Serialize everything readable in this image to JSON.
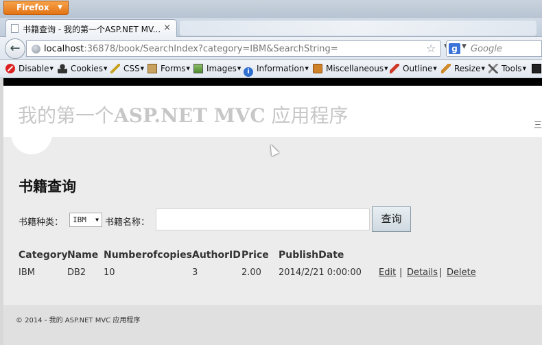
{
  "browser": {
    "app_button": "Firefox",
    "tab_title": "书籍查询 - 我的第一个ASP.NET MV...",
    "tab_close": "×",
    "url_host": "localhost",
    "url_rest": ":36878/book/SearchIndex?category=IBM&SearchString=",
    "search_placeholder": "Google",
    "search_engine_letter": "g"
  },
  "devtoolbar": {
    "items": [
      {
        "label": "Disable",
        "icon": "disable-icon"
      },
      {
        "label": "Cookies",
        "icon": "cookies-icon"
      },
      {
        "label": "CSS",
        "icon": "css-icon"
      },
      {
        "label": "Forms",
        "icon": "forms-icon"
      },
      {
        "label": "Images",
        "icon": "images-icon"
      },
      {
        "label": "Information",
        "icon": "information-icon"
      },
      {
        "label": "Miscellaneous",
        "icon": "miscellaneous-icon"
      },
      {
        "label": "Outline",
        "icon": "outline-icon"
      },
      {
        "label": "Resize",
        "icon": "resize-icon"
      },
      {
        "label": "Tools",
        "icon": "tools-icon"
      }
    ]
  },
  "page": {
    "site_title_pre": "我的第一个",
    "site_title_bold": "ASP.NET MVC",
    "site_title_post": " 应用程序",
    "header_edge_char": "三",
    "heading": "书籍查询",
    "category_label": "书籍种类：",
    "category_value": "IBM",
    "name_label": "书籍名称：",
    "search_input_value": "",
    "search_button": "查询",
    "table": {
      "headers": [
        "Category",
        "Name",
        "Numberofcopies",
        "AuthorID",
        "Price",
        "PublishDate"
      ],
      "rows": [
        {
          "category": "IBM",
          "name": "DB2",
          "copies": "10",
          "author": "3",
          "price": "2.00",
          "date": "2014/2/21 0:00:00"
        }
      ],
      "actions": {
        "edit": "Edit",
        "details": "Details",
        "delete": "Delete",
        "sep": "|"
      }
    },
    "footer": "© 2014 - 我的 ASP.NET MVC 应用程序"
  },
  "colors": {
    "firefox_orange": "#e27313",
    "site_title": "#c7c7c7",
    "content_bg": "#ececec"
  }
}
